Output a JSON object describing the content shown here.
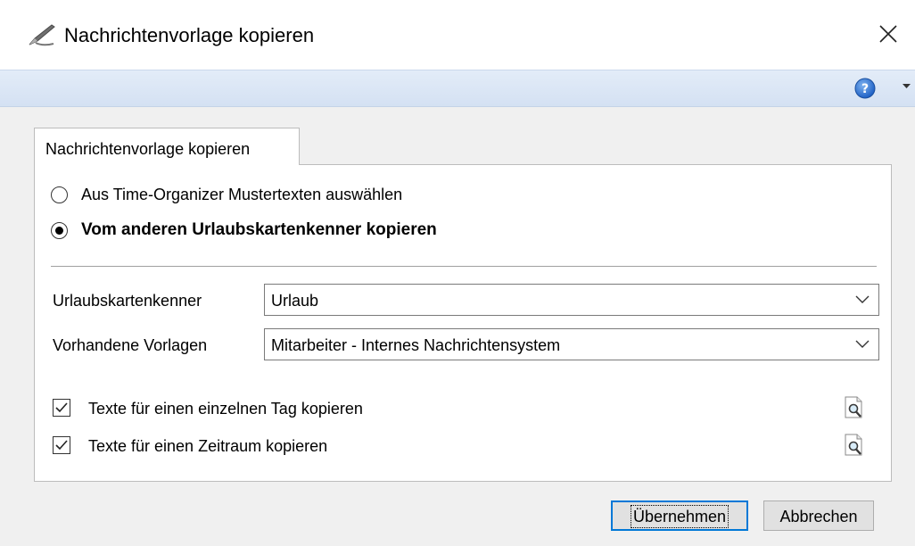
{
  "window": {
    "title": "Nachrichtenvorlage kopieren",
    "close_icon": "close-icon",
    "title_icon": "feather-pen-icon"
  },
  "helpbar": {
    "help_icon": "help-icon",
    "dropdown_icon": "dropdown-arrow-icon"
  },
  "tab": {
    "label": "Nachrichtenvorlage kopieren"
  },
  "options": {
    "radio1_label": "Aus Time-Organizer Mustertexten auswählen",
    "radio1_checked": false,
    "radio2_label": "Vom anderen Urlaubskartenkenner kopieren",
    "radio2_checked": true
  },
  "fields": {
    "urlaub_label": "Urlaubskartenkenner",
    "urlaub_value": "Urlaub",
    "vorlagen_label": "Vorhandene Vorlagen",
    "vorlagen_value": "Mitarbeiter - Internes Nachrichtensystem"
  },
  "checks": {
    "check1_label": "Texte für einen einzelnen Tag kopieren",
    "check1_checked": true,
    "check2_label": "Texte für einen Zeitraum kopieren",
    "check2_checked": true
  },
  "buttons": {
    "ok_label": "Übernehmen",
    "cancel_label": "Abbrechen"
  },
  "colors": {
    "accent": "#0078d7",
    "helpbar": "#dbe6f5"
  }
}
